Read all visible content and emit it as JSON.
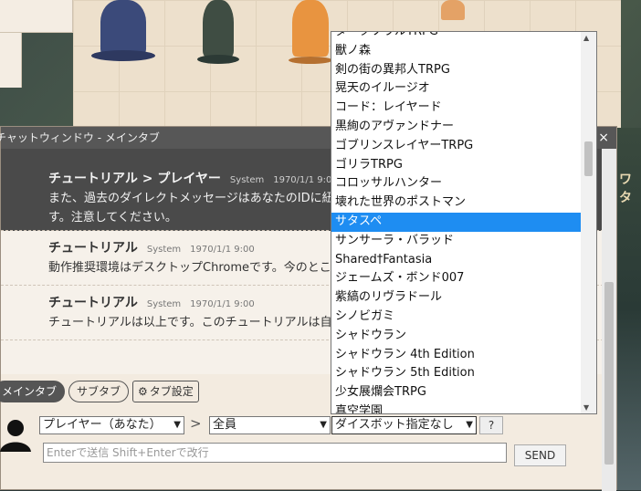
{
  "chat": {
    "title": "チャットウィンドウ - メインタブ",
    "close": "×",
    "messages": [
      {
        "name": "チュートリアル > プレイヤー",
        "sender_type": "System",
        "time": "1970/1/1 9:00",
        "text": "また、過去のダイレクトメッセージはあなたのIDに紐づいているので、IDが変わると見えなくなります。注意してください。"
      },
      {
        "name": "チュートリアル",
        "sender_type": "System",
        "time": "1970/1/1 9:00",
        "text": "動作推奨環境はデスクトップChromeです。今のところスマホでの動作は保証されません。"
      },
      {
        "name": "チュートリアル",
        "sender_type": "System",
        "time": "1970/1/1 9:00",
        "text": "チュートリアルは以上です。このチュートリアルは自動的に削除されることはありません。"
      }
    ],
    "tabs": {
      "main": "メインタブ",
      "sub": "サブタブ",
      "settings": "タブ設定"
    },
    "sender_select": "プレイヤー（あなた）",
    "separator": ">",
    "target_select": "全員",
    "dicebot_select": "ダイスボット指定なし",
    "help": "?",
    "input_placeholder": "Enterで送信  Shift+Enterで改行",
    "send": "SEND"
  },
  "scenery_text": "ワタ",
  "dicebot_options": {
    "items": [
      {
        "label": "ダークソウルTRPG"
      },
      {
        "label": "獸ノ森"
      },
      {
        "label": "剣の街の異邦人TRPG"
      },
      {
        "label": "晃天のイルージオ"
      },
      {
        "label": "コード：レイヤード"
      },
      {
        "label": "黒絢のアヴァンドナー"
      },
      {
        "label": "ゴブリンスレイヤーTRPG"
      },
      {
        "label": "ゴリラTRPG"
      },
      {
        "label": "コロッサルハンター"
      },
      {
        "label": "壊れた世界のポストマン"
      },
      {
        "label": "サタスペ",
        "selected": true
      },
      {
        "label": "サンサーラ・バラッド"
      },
      {
        "label": "Shared†Fantasia"
      },
      {
        "label": "ジェームズ・ボンド007"
      },
      {
        "label": "紫縞のリヴラドール"
      },
      {
        "label": "シノビガミ"
      },
      {
        "label": "シャドウラン"
      },
      {
        "label": "シャドウラン 4th Edition"
      },
      {
        "label": "シャドウラン 5th Edition"
      },
      {
        "label": "少女展爛会TRPG"
      },
      {
        "label": "真空学園"
      }
    ]
  },
  "colors": {
    "selected": "#1e8df2",
    "titlebar": "#575757"
  }
}
